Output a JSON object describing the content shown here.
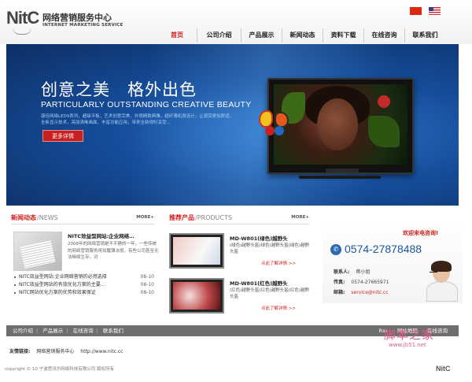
{
  "header": {
    "logo_mark": "NitC",
    "logo_cn": "网络营销服务中心",
    "logo_en": "INTERNET MARKETING SERVICE"
  },
  "nav": {
    "items": [
      {
        "label": "首页",
        "active": true
      },
      {
        "label": "公司介绍"
      },
      {
        "label": "产品展示"
      },
      {
        "label": "新闻动态"
      },
      {
        "label": "资料下载"
      },
      {
        "label": "在线咨询"
      },
      {
        "label": "联系我们"
      }
    ]
  },
  "banner": {
    "title_cn": "创意之美　格外出色",
    "title_en": "PARTICULARLY OUTSTANDING CREATIVE BEAUTY",
    "desc": "康佳网络LED9系列，超级平板，艺术创意完美，外观精致典雅，超纤薄机身设计，让观赏更加舒适，全新显示技术，亮丽清晰画面，丰富功能应用，带来全新视听享受…",
    "button_label": "更多详情"
  },
  "news": {
    "title": "新闻动态",
    "title_en": "NEWS",
    "more": "MORE+",
    "featured_title": "NITC效益型网站:企业网络…",
    "featured_summary": "2008年的网络营销是不平静的一年，一些传统的网络营销服务将如履薄冰般，有些公司甚至无法继续生存。对",
    "items": [
      {
        "title": "NITC效益型网站:企业网络营销的必然选择",
        "date": "08-10"
      },
      {
        "title": "NITC效益型网站的有效优化方案的主要…",
        "date": "08-10"
      },
      {
        "title": "NITC网站优化方案的优势和效果保证",
        "date": "08-10"
      }
    ]
  },
  "products": {
    "title": "推荐产品",
    "title_en": "PRODUCTS",
    "more": "MORE+",
    "items": [
      {
        "name": "MD-W801(绿色)越野头",
        "desc": "(绿色)越野头盔(绿色)越野头盔(绿色)越野头盔",
        "link": "点此了解详情 >>"
      },
      {
        "name": "MD-W801(红色)越野头",
        "desc": "(红色)越野头盔(红色)越野头盔(红色)越野头盔",
        "link": "点此了解详情 >>"
      }
    ]
  },
  "contact": {
    "title": "欢迎来电咨询!",
    "phone": "0574-27878488",
    "contact_label": "联系人:",
    "contact_value": "蒋小姐",
    "fax_label": "传真:",
    "fax_value": "0574-27665971",
    "email_label": "邮箱:",
    "email_value": "service@nitc.cc"
  },
  "footer": {
    "links": [
      "公司介绍",
      "产品展示",
      "在线咨询",
      "联系我们"
    ],
    "right_links": [
      "Rss",
      "网站地图",
      "在线咨询"
    ],
    "friend_label": "友情链接:",
    "friend_links": [
      "网络营销服务中心",
      "http://www.nitc.cc"
    ],
    "copyright": "copyright © 10 宁波思讯尔网络科技有限公司  版权所有",
    "logo": "NitC"
  },
  "watermark": {
    "main": "脚本之家",
    "sub": "www.jb51.net"
  },
  "colors": {
    "accent": "#d42020",
    "brand_blue": "#1a56a0",
    "footer_bar": "#6e6e6e"
  }
}
